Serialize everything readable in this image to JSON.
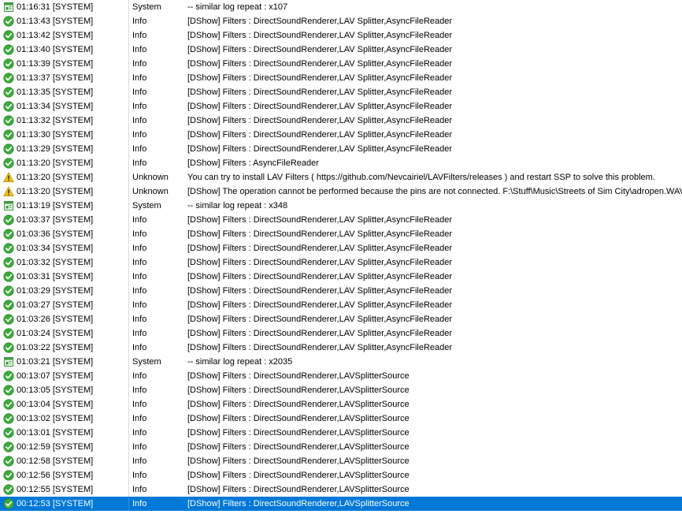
{
  "colors": {
    "selection": "#0078d7",
    "info_icon": "#3cab3c",
    "warning_icon": "#f2c311",
    "system_icon": "#3f9a3f"
  },
  "icons": {
    "info": "check-circle-icon",
    "warning": "warning-triangle-icon",
    "system": "system-window-icon"
  },
  "log": {
    "rows": [
      {
        "icon": "system",
        "time": "01:16:31 [SYSTEM]",
        "level": "System",
        "message": "-- similar log repeat : x107"
      },
      {
        "icon": "info",
        "time": "01:13:43 [SYSTEM]",
        "level": "Info",
        "message": "[DShow] Filters : DirectSoundRenderer,LAV Splitter,AsyncFileReader"
      },
      {
        "icon": "info",
        "time": "01:13:42 [SYSTEM]",
        "level": "Info",
        "message": "[DShow] Filters : DirectSoundRenderer,LAV Splitter,AsyncFileReader"
      },
      {
        "icon": "info",
        "time": "01:13:40 [SYSTEM]",
        "level": "Info",
        "message": "[DShow] Filters : DirectSoundRenderer,LAV Splitter,AsyncFileReader"
      },
      {
        "icon": "info",
        "time": "01:13:39 [SYSTEM]",
        "level": "Info",
        "message": "[DShow] Filters : DirectSoundRenderer,LAV Splitter,AsyncFileReader"
      },
      {
        "icon": "info",
        "time": "01:13:37 [SYSTEM]",
        "level": "Info",
        "message": "[DShow] Filters : DirectSoundRenderer,LAV Splitter,AsyncFileReader"
      },
      {
        "icon": "info",
        "time": "01:13:35 [SYSTEM]",
        "level": "Info",
        "message": "[DShow] Filters : DirectSoundRenderer,LAV Splitter,AsyncFileReader"
      },
      {
        "icon": "info",
        "time": "01:13:34 [SYSTEM]",
        "level": "Info",
        "message": "[DShow] Filters : DirectSoundRenderer,LAV Splitter,AsyncFileReader"
      },
      {
        "icon": "info",
        "time": "01:13:32 [SYSTEM]",
        "level": "Info",
        "message": "[DShow] Filters : DirectSoundRenderer,LAV Splitter,AsyncFileReader"
      },
      {
        "icon": "info",
        "time": "01:13:30 [SYSTEM]",
        "level": "Info",
        "message": "[DShow] Filters : DirectSoundRenderer,LAV Splitter,AsyncFileReader"
      },
      {
        "icon": "info",
        "time": "01:13:29 [SYSTEM]",
        "level": "Info",
        "message": "[DShow] Filters : DirectSoundRenderer,LAV Splitter,AsyncFileReader"
      },
      {
        "icon": "info",
        "time": "01:13:20 [SYSTEM]",
        "level": "Info",
        "message": "[DShow] Filters : AsyncFileReader"
      },
      {
        "icon": "warning",
        "time": "01:13:20 [SYSTEM]",
        "level": "Unknown",
        "message": "You can try to install LAV Filters ( https://github.com/Nevcairiel/LAVFilters/releases ) and restart SSP to solve this problem."
      },
      {
        "icon": "warning",
        "time": "01:13:20 [SYSTEM]",
        "level": "Unknown",
        "message": "[DShow] The operation cannot be performed because the pins are not connected. F:\\Stuff\\Music\\Streets of Sim City\\adropen.WAV"
      },
      {
        "icon": "system",
        "time": "01:13:19 [SYSTEM]",
        "level": "System",
        "message": "-- similar log repeat : x348"
      },
      {
        "icon": "info",
        "time": "01:03:37 [SYSTEM]",
        "level": "Info",
        "message": "[DShow] Filters : DirectSoundRenderer,LAV Splitter,AsyncFileReader"
      },
      {
        "icon": "info",
        "time": "01:03:36 [SYSTEM]",
        "level": "Info",
        "message": "[DShow] Filters : DirectSoundRenderer,LAV Splitter,AsyncFileReader"
      },
      {
        "icon": "info",
        "time": "01:03:34 [SYSTEM]",
        "level": "Info",
        "message": "[DShow] Filters : DirectSoundRenderer,LAV Splitter,AsyncFileReader"
      },
      {
        "icon": "info",
        "time": "01:03:32 [SYSTEM]",
        "level": "Info",
        "message": "[DShow] Filters : DirectSoundRenderer,LAV Splitter,AsyncFileReader"
      },
      {
        "icon": "info",
        "time": "01:03:31 [SYSTEM]",
        "level": "Info",
        "message": "[DShow] Filters : DirectSoundRenderer,LAV Splitter,AsyncFileReader"
      },
      {
        "icon": "info",
        "time": "01:03:29 [SYSTEM]",
        "level": "Info",
        "message": "[DShow] Filters : DirectSoundRenderer,LAV Splitter,AsyncFileReader"
      },
      {
        "icon": "info",
        "time": "01:03:27 [SYSTEM]",
        "level": "Info",
        "message": "[DShow] Filters : DirectSoundRenderer,LAV Splitter,AsyncFileReader"
      },
      {
        "icon": "info",
        "time": "01:03:26 [SYSTEM]",
        "level": "Info",
        "message": "[DShow] Filters : DirectSoundRenderer,LAV Splitter,AsyncFileReader"
      },
      {
        "icon": "info",
        "time": "01:03:24 [SYSTEM]",
        "level": "Info",
        "message": "[DShow] Filters : DirectSoundRenderer,LAV Splitter,AsyncFileReader"
      },
      {
        "icon": "info",
        "time": "01:03:22 [SYSTEM]",
        "level": "Info",
        "message": "[DShow] Filters : DirectSoundRenderer,LAV Splitter,AsyncFileReader"
      },
      {
        "icon": "system",
        "time": "01:03:21 [SYSTEM]",
        "level": "System",
        "message": "-- similar log repeat : x2035"
      },
      {
        "icon": "info",
        "time": "00:13:07 [SYSTEM]",
        "level": "Info",
        "message": "[DShow] Filters : DirectSoundRenderer,LAVSplitterSource"
      },
      {
        "icon": "info",
        "time": "00:13:05 [SYSTEM]",
        "level": "Info",
        "message": "[DShow] Filters : DirectSoundRenderer,LAVSplitterSource"
      },
      {
        "icon": "info",
        "time": "00:13:04 [SYSTEM]",
        "level": "Info",
        "message": "[DShow] Filters : DirectSoundRenderer,LAVSplitterSource"
      },
      {
        "icon": "info",
        "time": "00:13:02 [SYSTEM]",
        "level": "Info",
        "message": "[DShow] Filters : DirectSoundRenderer,LAVSplitterSource"
      },
      {
        "icon": "info",
        "time": "00:13:01 [SYSTEM]",
        "level": "Info",
        "message": "[DShow] Filters : DirectSoundRenderer,LAVSplitterSource"
      },
      {
        "icon": "info",
        "time": "00:12:59 [SYSTEM]",
        "level": "Info",
        "message": "[DShow] Filters : DirectSoundRenderer,LAVSplitterSource"
      },
      {
        "icon": "info",
        "time": "00:12:58 [SYSTEM]",
        "level": "Info",
        "message": "[DShow] Filters : DirectSoundRenderer,LAVSplitterSource"
      },
      {
        "icon": "info",
        "time": "00:12:56 [SYSTEM]",
        "level": "Info",
        "message": "[DShow] Filters : DirectSoundRenderer,LAVSplitterSource"
      },
      {
        "icon": "info",
        "time": "00:12:55 [SYSTEM]",
        "level": "Info",
        "message": "[DShow] Filters : DirectSoundRenderer,LAVSplitterSource"
      },
      {
        "icon": "info",
        "time": "00:12:53 [SYSTEM]",
        "level": "Info",
        "message": "[DShow] Filters : DirectSoundRenderer,LAVSplitterSource",
        "selected": true
      }
    ]
  }
}
